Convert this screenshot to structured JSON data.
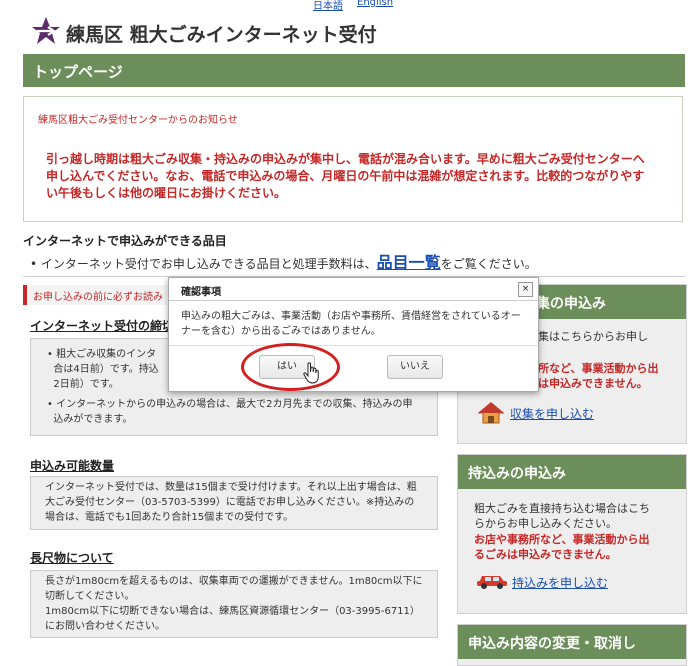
{
  "lang": {
    "japanese": "日本語",
    "english": "English"
  },
  "header": {
    "title": "練馬区 粗大ごみインターネット受付",
    "logo_icon": "star-arrow-icon"
  },
  "topbar": {
    "title": "トップページ"
  },
  "notice": {
    "title": "練馬区粗大ごみ受付センターからのお知らせ",
    "lines": [
      "引っ越し時期は粗大ごみ収集・持込みの申込みが集中し、電話が混み合います。早めに粗大ごみ受付センターへ",
      "申し込んでください。なお、電話で申込みの場合、月曜日の午前中は混雑が想定されます。比較的つながりやす",
      "い午後もしくは他の曜日にお掛けください。"
    ]
  },
  "items": {
    "heading": "インターネットで申込みができる品目",
    "bullet_before": "インターネット受付でお申し込みできる品目と処理手数料は、",
    "bullet_link": "品目一覧",
    "bullet_after": "をご覧ください。"
  },
  "before_label": "お申し込みの前に必ずお読み",
  "deadline": {
    "heading": "インターネット受付の締切",
    "b1a": "粗大ごみ収集のインタ",
    "b1b": "合は4日前）です。持込",
    "b1c": "2日前）です。",
    "b2a": "インターネットからの申込みの場合は、最大で2カ月先までの収集、持込みの申",
    "b2b": "込みができます。"
  },
  "quantity": {
    "heading": "申込み可能数量",
    "l1": "インターネット受付では、数量は15個まで受け付けます。それ以上出す場合は、粗",
    "l2": "大ごみ受付センター（03-5703-5399）に電話でお申し込みください。※持込みの",
    "l3": "場合は、電話でも1回あたり合計15個までの受付です。"
  },
  "long": {
    "heading": "長尺物について",
    "l1": "長さが1m80cmを超えるものは、収集車両での運搬ができません。1m80cm以下に",
    "l2": "切断してください。",
    "l3": "1m80cm以下に切断できない場合は、練馬区資源循環センター（03-3995-6711）",
    "l4": "にお問い合わせください。"
  },
  "side_collect": {
    "head": "集の申込み",
    "t1": "集はこちらからお申し",
    "t2": "所など、事業活動から出",
    "t3": "は申込みできません。",
    "link": "収集を申し込む"
  },
  "side_bring": {
    "head": "持込みの申込み",
    "t1": "粗大ごみを直接持ち込む場合はこち",
    "t2": "らからお申し込みください。",
    "t3": "お店や事務所など、事業活動から出",
    "t4": "るごみは申込みできません。",
    "link": "持込みを申し込む"
  },
  "side_change": {
    "head": "申込み内容の変更・取消し"
  },
  "dialog": {
    "title": "確認事項",
    "close": "×",
    "message_l1": "申込みの粗大ごみは、事業活動（お店や事務所、賃借経営をされているオー",
    "message_l2": "ナーを含む）から出るごみではありません。",
    "yes": "はい",
    "no": "いいえ"
  },
  "colors": {
    "brand_green": "#6b8e5a",
    "alert_red": "#c62828",
    "link_blue": "#1a4fb0"
  }
}
